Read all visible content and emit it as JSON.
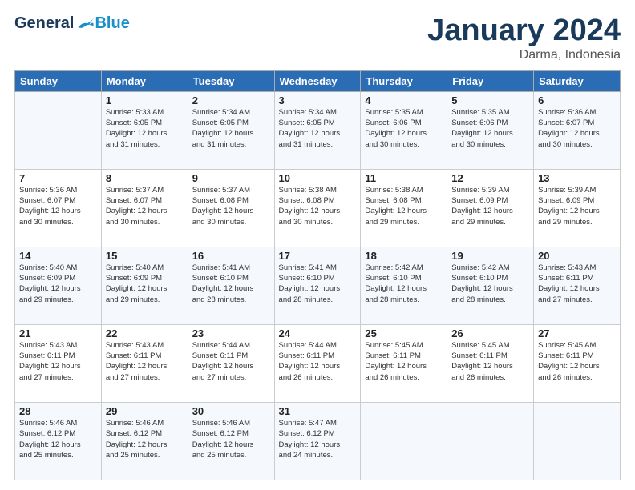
{
  "logo": {
    "text_general": "General",
    "text_blue": "Blue"
  },
  "header": {
    "month": "January 2024",
    "location": "Darma, Indonesia"
  },
  "weekdays": [
    "Sunday",
    "Monday",
    "Tuesday",
    "Wednesday",
    "Thursday",
    "Friday",
    "Saturday"
  ],
  "weeks": [
    [
      {
        "day": "",
        "info": ""
      },
      {
        "day": "1",
        "info": "Sunrise: 5:33 AM\nSunset: 6:05 PM\nDaylight: 12 hours\nand 31 minutes."
      },
      {
        "day": "2",
        "info": "Sunrise: 5:34 AM\nSunset: 6:05 PM\nDaylight: 12 hours\nand 31 minutes."
      },
      {
        "day": "3",
        "info": "Sunrise: 5:34 AM\nSunset: 6:05 PM\nDaylight: 12 hours\nand 31 minutes."
      },
      {
        "day": "4",
        "info": "Sunrise: 5:35 AM\nSunset: 6:06 PM\nDaylight: 12 hours\nand 30 minutes."
      },
      {
        "day": "5",
        "info": "Sunrise: 5:35 AM\nSunset: 6:06 PM\nDaylight: 12 hours\nand 30 minutes."
      },
      {
        "day": "6",
        "info": "Sunrise: 5:36 AM\nSunset: 6:07 PM\nDaylight: 12 hours\nand 30 minutes."
      }
    ],
    [
      {
        "day": "7",
        "info": "Sunrise: 5:36 AM\nSunset: 6:07 PM\nDaylight: 12 hours\nand 30 minutes."
      },
      {
        "day": "8",
        "info": "Sunrise: 5:37 AM\nSunset: 6:07 PM\nDaylight: 12 hours\nand 30 minutes."
      },
      {
        "day": "9",
        "info": "Sunrise: 5:37 AM\nSunset: 6:08 PM\nDaylight: 12 hours\nand 30 minutes."
      },
      {
        "day": "10",
        "info": "Sunrise: 5:38 AM\nSunset: 6:08 PM\nDaylight: 12 hours\nand 30 minutes."
      },
      {
        "day": "11",
        "info": "Sunrise: 5:38 AM\nSunset: 6:08 PM\nDaylight: 12 hours\nand 29 minutes."
      },
      {
        "day": "12",
        "info": "Sunrise: 5:39 AM\nSunset: 6:09 PM\nDaylight: 12 hours\nand 29 minutes."
      },
      {
        "day": "13",
        "info": "Sunrise: 5:39 AM\nSunset: 6:09 PM\nDaylight: 12 hours\nand 29 minutes."
      }
    ],
    [
      {
        "day": "14",
        "info": "Sunrise: 5:40 AM\nSunset: 6:09 PM\nDaylight: 12 hours\nand 29 minutes."
      },
      {
        "day": "15",
        "info": "Sunrise: 5:40 AM\nSunset: 6:09 PM\nDaylight: 12 hours\nand 29 minutes."
      },
      {
        "day": "16",
        "info": "Sunrise: 5:41 AM\nSunset: 6:10 PM\nDaylight: 12 hours\nand 28 minutes."
      },
      {
        "day": "17",
        "info": "Sunrise: 5:41 AM\nSunset: 6:10 PM\nDaylight: 12 hours\nand 28 minutes."
      },
      {
        "day": "18",
        "info": "Sunrise: 5:42 AM\nSunset: 6:10 PM\nDaylight: 12 hours\nand 28 minutes."
      },
      {
        "day": "19",
        "info": "Sunrise: 5:42 AM\nSunset: 6:10 PM\nDaylight: 12 hours\nand 28 minutes."
      },
      {
        "day": "20",
        "info": "Sunrise: 5:43 AM\nSunset: 6:11 PM\nDaylight: 12 hours\nand 27 minutes."
      }
    ],
    [
      {
        "day": "21",
        "info": "Sunrise: 5:43 AM\nSunset: 6:11 PM\nDaylight: 12 hours\nand 27 minutes."
      },
      {
        "day": "22",
        "info": "Sunrise: 5:43 AM\nSunset: 6:11 PM\nDaylight: 12 hours\nand 27 minutes."
      },
      {
        "day": "23",
        "info": "Sunrise: 5:44 AM\nSunset: 6:11 PM\nDaylight: 12 hours\nand 27 minutes."
      },
      {
        "day": "24",
        "info": "Sunrise: 5:44 AM\nSunset: 6:11 PM\nDaylight: 12 hours\nand 26 minutes."
      },
      {
        "day": "25",
        "info": "Sunrise: 5:45 AM\nSunset: 6:11 PM\nDaylight: 12 hours\nand 26 minutes."
      },
      {
        "day": "26",
        "info": "Sunrise: 5:45 AM\nSunset: 6:11 PM\nDaylight: 12 hours\nand 26 minutes."
      },
      {
        "day": "27",
        "info": "Sunrise: 5:45 AM\nSunset: 6:11 PM\nDaylight: 12 hours\nand 26 minutes."
      }
    ],
    [
      {
        "day": "28",
        "info": "Sunrise: 5:46 AM\nSunset: 6:12 PM\nDaylight: 12 hours\nand 25 minutes."
      },
      {
        "day": "29",
        "info": "Sunrise: 5:46 AM\nSunset: 6:12 PM\nDaylight: 12 hours\nand 25 minutes."
      },
      {
        "day": "30",
        "info": "Sunrise: 5:46 AM\nSunset: 6:12 PM\nDaylight: 12 hours\nand 25 minutes."
      },
      {
        "day": "31",
        "info": "Sunrise: 5:47 AM\nSunset: 6:12 PM\nDaylight: 12 hours\nand 24 minutes."
      },
      {
        "day": "",
        "info": ""
      },
      {
        "day": "",
        "info": ""
      },
      {
        "day": "",
        "info": ""
      }
    ]
  ]
}
